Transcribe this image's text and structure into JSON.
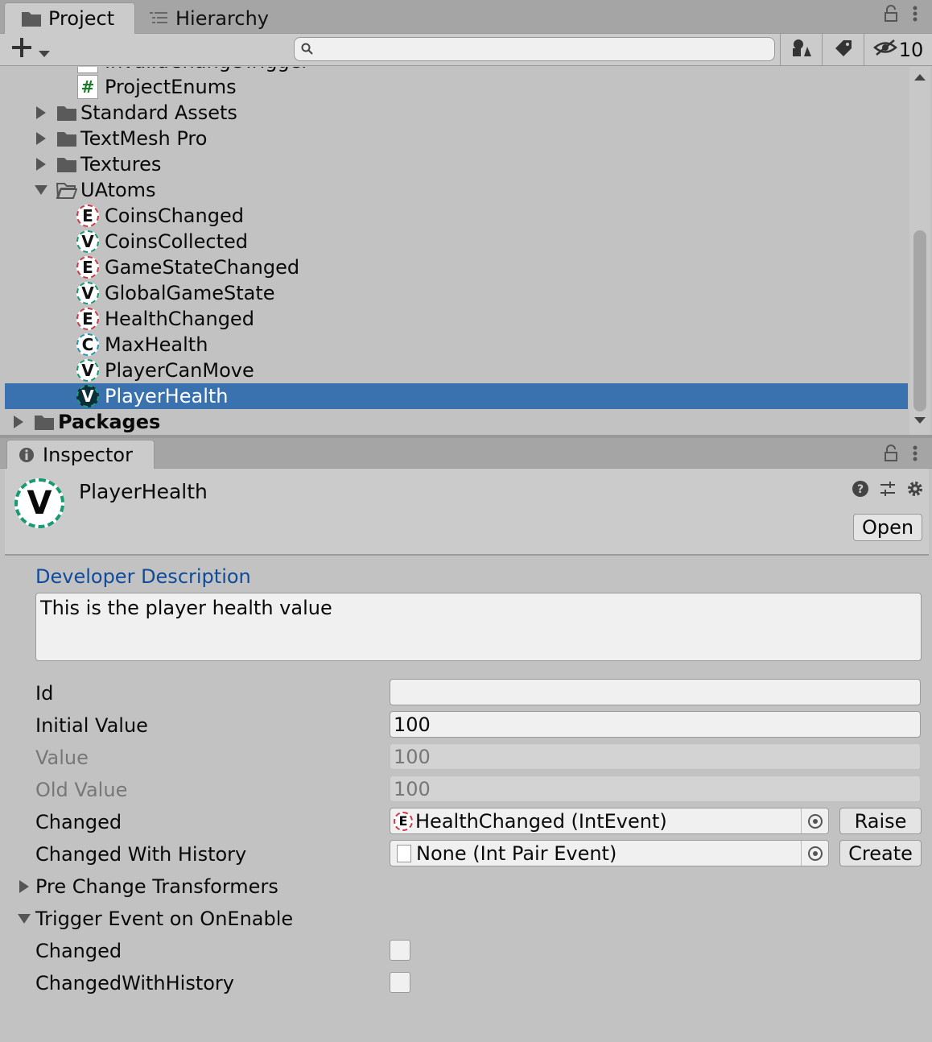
{
  "project_panel": {
    "tabs": [
      {
        "label": "Project",
        "icon": "folder-icon"
      },
      {
        "label": "Hierarchy",
        "icon": "hierarchy-list-icon"
      }
    ],
    "search": {
      "placeholder": "",
      "value": ""
    },
    "hidden_count": "10",
    "tree": [
      {
        "label": "InvalidChangeTrigger",
        "kind": "script",
        "icon": "#",
        "level": 2,
        "partial": true
      },
      {
        "label": "ProjectEnums",
        "kind": "script",
        "icon": "#",
        "level": 2
      },
      {
        "label": "Standard Assets",
        "kind": "folder",
        "expanded": false,
        "level": 1
      },
      {
        "label": "TextMesh Pro",
        "kind": "folder",
        "expanded": false,
        "level": 1
      },
      {
        "label": "Textures",
        "kind": "folder",
        "expanded": false,
        "level": 1
      },
      {
        "label": "UAtoms",
        "kind": "folder",
        "expanded": true,
        "level": 1
      },
      {
        "label": "CoinsChanged",
        "kind": "atom",
        "icon": "E",
        "level": 2
      },
      {
        "label": "CoinsCollected",
        "kind": "atom",
        "icon": "V",
        "level": 2
      },
      {
        "label": "GameStateChanged",
        "kind": "atom",
        "icon": "E",
        "level": 2
      },
      {
        "label": "GlobalGameState",
        "kind": "atom",
        "icon": "V",
        "level": 2
      },
      {
        "label": "HealthChanged",
        "kind": "atom",
        "icon": "E",
        "level": 2
      },
      {
        "label": "MaxHealth",
        "kind": "atom",
        "icon": "C",
        "level": 2
      },
      {
        "label": "PlayerCanMove",
        "kind": "atom",
        "icon": "V",
        "level": 2
      },
      {
        "label": "PlayerHealth",
        "kind": "atom",
        "icon": "V",
        "level": 2,
        "selected": true
      },
      {
        "label": "Packages",
        "kind": "folder",
        "expanded": false,
        "level": 0,
        "bold": true
      }
    ]
  },
  "inspector": {
    "tab_label": "Inspector",
    "object_name": "PlayerHealth",
    "object_icon": "V",
    "open_label": "Open",
    "developer_description_label": "Developer Description",
    "developer_description": "This is the player health value",
    "props": {
      "id": {
        "label": "Id",
        "value": ""
      },
      "initial_value": {
        "label": "Initial Value",
        "value": "100"
      },
      "value": {
        "label": "Value",
        "value": "100"
      },
      "old_value": {
        "label": "Old Value",
        "value": "100"
      },
      "changed": {
        "label": "Changed",
        "value": "HealthChanged (IntEvent)",
        "icon": "E",
        "button": "Raise"
      },
      "changed_with_history": {
        "label": "Changed With History",
        "value": "None (Int Pair Event)",
        "button": "Create"
      }
    },
    "pre_change_transformers": {
      "label": "Pre Change Transformers",
      "expanded": false
    },
    "trigger_on_enable": {
      "label": "Trigger Event on OnEnable",
      "expanded": true,
      "changed": {
        "label": "Changed",
        "checked": false
      },
      "changed_with_history": {
        "label": "ChangedWithHistory",
        "checked": false
      }
    }
  }
}
